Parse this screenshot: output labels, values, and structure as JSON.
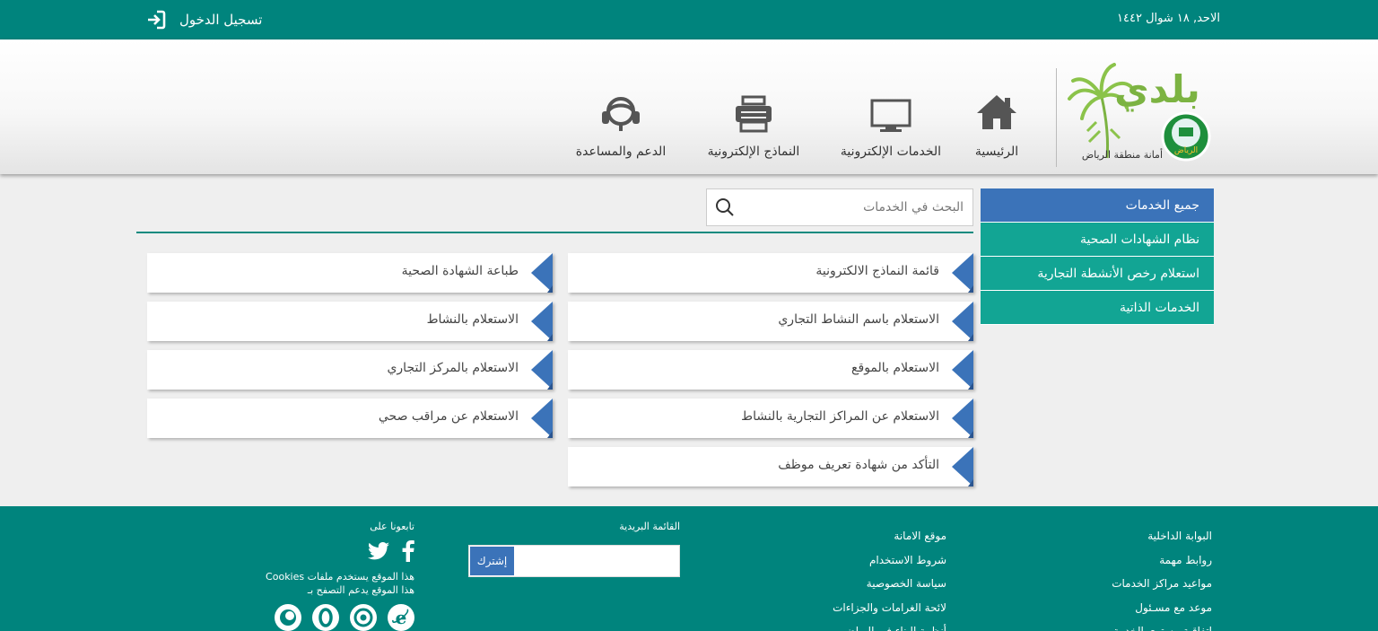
{
  "topbar": {
    "date": "الاحد, ١٨ شوال ١٤٤٢",
    "login_label": "تسجيل الدخول",
    "login_icon": "login-icon"
  },
  "header": {
    "logo_text": "بلدي",
    "logo_caption": "أمانة منطقة الرياض",
    "emblem_text": "الرياض",
    "nav": [
      {
        "label": "الرئيسية",
        "icon": "home-icon"
      },
      {
        "label": "الخدمات الإلكترونية",
        "icon": "monitor-icon"
      },
      {
        "label": "النماذج الإلكترونية",
        "icon": "printer-icon"
      },
      {
        "label": "الدعم والمساعدة",
        "icon": "headset-icon"
      }
    ]
  },
  "sidebar": {
    "items": [
      {
        "label": "جميع الخدمات",
        "active": true
      },
      {
        "label": "نظام الشهادات الصحية",
        "active": false
      },
      {
        "label": "استعلام رخص الأنشطة التجارية",
        "active": false
      },
      {
        "label": "الخدمات الذاتية",
        "active": false
      }
    ]
  },
  "search": {
    "placeholder": "البحث في الخدمات",
    "value": ""
  },
  "services": {
    "right_column": [
      "قائمة النماذج الالكترونية",
      "الاستعلام باسم النشاط التجاري",
      "الاستعلام بالموقع",
      "الاستعلام عن المراكز التجارية بالنشاط",
      "التأكد من شهادة تعريف موظف"
    ],
    "left_column": [
      "طباعة الشهادة الصحية",
      "الاستعلام بالنشاط",
      "الاستعلام بالمركز التجاري",
      "الاستعلام عن مراقب صحي"
    ]
  },
  "footer": {
    "col1": [
      "البوابة الداخلية",
      "روابط مهمة",
      "مواعيد مراكز الخدمات",
      "موعد مع مسـئول",
      "اتفاقية مستوى الخدمة"
    ],
    "col2": [
      "موقع الامانة",
      "شروط الاستخدام",
      "سياسة الخصوصية",
      "لائحة الغرامات والجزاءات",
      "أنظمة البناء في الرياض"
    ],
    "newsletter": {
      "title": "القائمة البريدية",
      "button": "إشترك",
      "placeholder": ""
    },
    "social": {
      "title": "تابعونا على",
      "icons": [
        "facebook-icon",
        "twitter-icon"
      ],
      "cookies_note": "هذا الموقع يستخدم ملفات Cookies",
      "browsers_note": "هذا الموقع يدعم التصفح بـ",
      "browsers": [
        "ie-icon",
        "chrome-icon",
        "opera-icon",
        "firefox-icon"
      ]
    }
  },
  "colors": {
    "teal": "#00847d",
    "sidebar_teal": "#12a594",
    "accent_blue": "#3b73b9"
  }
}
